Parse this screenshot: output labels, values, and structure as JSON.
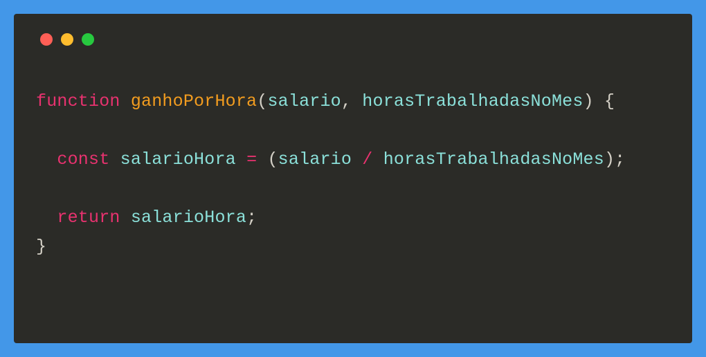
{
  "code": {
    "l1": {
      "fn_kw": "function",
      "fn_name": "ganhoPorHora",
      "paren_o": "(",
      "p1": "salario",
      "comma": ", ",
      "p2": "horasTrabalhadasNoMes",
      "paren_c": ")",
      "brace_o": " {"
    },
    "l2_blank": "",
    "l3": {
      "indent": "  ",
      "const_kw": "const",
      "sp1": " ",
      "var": "salarioHora",
      "sp2": " ",
      "eq": "=",
      "sp3": " ",
      "po": "(",
      "a": "salario",
      "sp4": " ",
      "div": "/",
      "sp5": " ",
      "b": "horasTrabalhadasNoMes",
      "pc": ")",
      "semi": ";"
    },
    "l4_blank": "",
    "l5": {
      "indent": "  ",
      "ret_kw": "return",
      "sp1": " ",
      "var": "salarioHora",
      "semi": ";"
    },
    "l6": {
      "brace_c": "}"
    }
  }
}
